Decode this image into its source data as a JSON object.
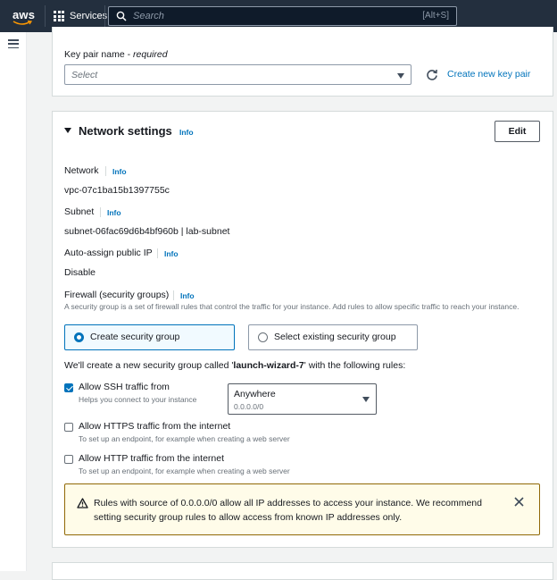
{
  "topnav": {
    "logo_text": "aws",
    "services_label": "Services",
    "search_placeholder": "Search",
    "search_shortcut": "[Alt+S]"
  },
  "keypair": {
    "label": "Key pair name - ",
    "label_required": "required",
    "select_placeholder": "Select",
    "create_link": "Create new key pair"
  },
  "network_settings": {
    "title": "Network settings",
    "title_info": "Info",
    "edit_button": "Edit",
    "network_label": "Network",
    "network_info": "Info",
    "network_value": "vpc-07c1ba15b1397755c",
    "subnet_label": "Subnet",
    "subnet_info": "Info",
    "subnet_value": "subnet-06fac69d6b4bf960b | lab-subnet",
    "public_ip_label": "Auto-assign public IP",
    "public_ip_info": "Info",
    "public_ip_value": "Disable",
    "firewall_label": "Firewall (security groups)",
    "firewall_info": "Info",
    "firewall_desc": "A security group is a set of firewall rules that control the traffic for your instance. Add rules to allow specific traffic to reach your instance.",
    "option_create": "Create security group",
    "option_existing": "Select existing security group",
    "create_msg_prefix": "We'll create a new security group called '",
    "create_msg_name": "launch-wizard-7",
    "create_msg_suffix": "' with the following rules:",
    "rules": [
      {
        "label": "Allow SSH traffic from",
        "desc": "Helps you connect to your instance",
        "checked": true
      },
      {
        "label": "Allow HTTPS traffic from the internet",
        "desc": "To set up an endpoint, for example when creating a web server",
        "checked": false
      },
      {
        "label": "Allow HTTP traffic from the internet",
        "desc": "To set up an endpoint, for example when creating a web server",
        "checked": false
      }
    ],
    "ssh_source": {
      "value": "Anywhere",
      "sub": "0.0.0.0/0"
    },
    "warning_text": "Rules with source of 0.0.0.0/0 allow all IP addresses to access your instance. We recommend setting security group rules to allow access from known IP addresses only."
  },
  "colors": {
    "topbar": "#232f3e",
    "link": "#0073bb",
    "warning_border": "#906806",
    "warning_bg": "#fffce9"
  }
}
